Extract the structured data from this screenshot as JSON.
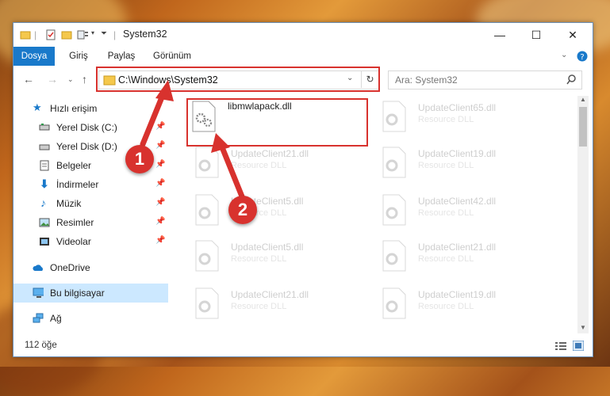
{
  "window": {
    "title": "System32",
    "controls": {
      "minimize": "—",
      "maximize": "☐",
      "close": "✕"
    }
  },
  "ribbon": {
    "tabs": [
      "Dosya",
      "Giriş",
      "Paylaş",
      "Görünüm"
    ],
    "file_tab_color": "#1979ca"
  },
  "address": {
    "path": "C:\\Windows\\System32",
    "search_placeholder": "Ara: System32"
  },
  "sidebar": {
    "quick_access": "Hızlı erişim",
    "items": [
      {
        "label": "Yerel Disk (C:)",
        "icon": "drive-icon",
        "pinned": true
      },
      {
        "label": "Yerel Disk (D:)",
        "icon": "drive-icon",
        "pinned": true
      },
      {
        "label": "Belgeler",
        "icon": "documents-icon",
        "pinned": true
      },
      {
        "label": "İndirmeler",
        "icon": "downloads-icon",
        "pinned": true
      },
      {
        "label": "Müzik",
        "icon": "music-icon",
        "pinned": true
      },
      {
        "label": "Resimler",
        "icon": "pictures-icon",
        "pinned": true
      },
      {
        "label": "Videolar",
        "icon": "videos-icon",
        "pinned": true
      }
    ],
    "onedrive": "OneDrive",
    "this_pc": "Bu bilgisayar",
    "network": "Ağ"
  },
  "files": {
    "highlighted": {
      "name": "libmwlapack.dll"
    },
    "faded": [
      {
        "name": "UpdateClient65.dll",
        "type": "Resource DLL"
      },
      {
        "name": "UpdateClient21.dll",
        "type": "Resource DLL"
      },
      {
        "name": "UpdateClient19.dll",
        "type": "Resource DLL"
      },
      {
        "name": "UpdateClient5.dll",
        "type": "Resource DLL"
      },
      {
        "name": "UpdateClient42.dll",
        "type": "Resource DLL"
      },
      {
        "name": "UpdateClient5.dll",
        "type": "Resource DLL"
      },
      {
        "name": "UpdateClient21.dll",
        "type": "Resource DLL"
      },
      {
        "name": "UpdateClient21.dll",
        "type": "Resource DLL"
      },
      {
        "name": "UpdateClient19.dll",
        "type": "Resource DLL"
      }
    ]
  },
  "status": {
    "item_count": "112 öğe"
  },
  "annotations": {
    "step1": "1",
    "step2": "2",
    "color": "#d8322e"
  }
}
